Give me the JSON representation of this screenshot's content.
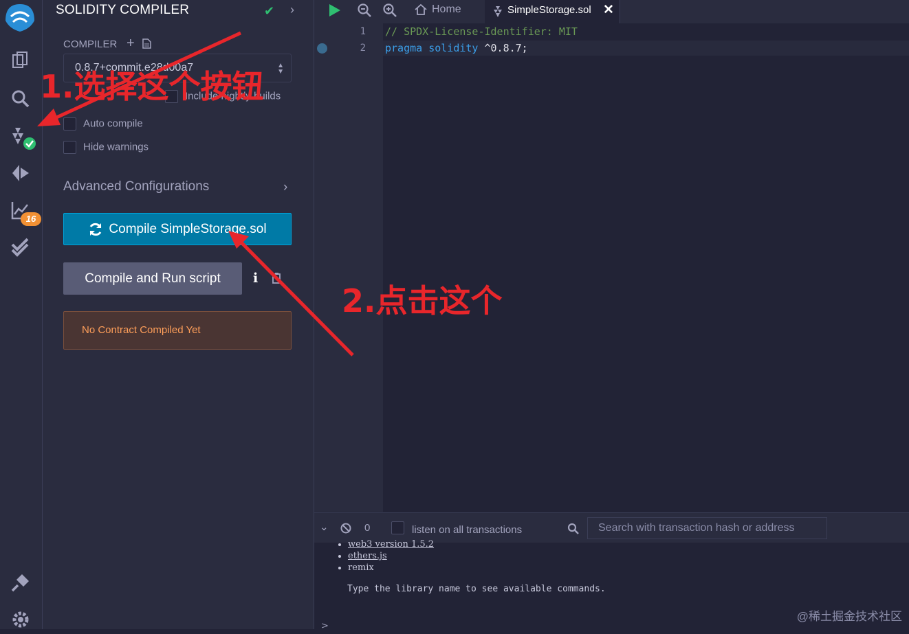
{
  "sidebar": {
    "icons": [
      "remix-logo-icon",
      "file-explorer-icon",
      "search-icon",
      "solidity-compiler-icon",
      "deploy-run-icon",
      "analysis-icon",
      "test-icon",
      "plugin-manager-icon",
      "settings-icon"
    ],
    "analysis_badge": "16"
  },
  "panel": {
    "title": "SOLIDITY COMPILER",
    "compiler_label": "COMPILER",
    "compiler_version": "0.8.7+commit.e28d00a7",
    "nightly_label": "Include nightly builds",
    "auto_compile_label": "Auto compile",
    "hide_warnings_label": "Hide warnings",
    "advanced_label": "Advanced Configurations",
    "compile_button": "Compile SimpleStorage.sol",
    "run_button": "Compile and Run script",
    "alert_text": "No Contract Compiled Yet"
  },
  "tabs": {
    "home_label": "Home",
    "active_file": "SimpleStorage.sol"
  },
  "editor": {
    "lines": [
      {
        "num": "1",
        "comment": "// SPDX-License-Identifier: MIT"
      },
      {
        "num": "2",
        "kw1": "pragma",
        "kw2": "solidity",
        "rest": "^0.8.7;"
      }
    ]
  },
  "terminal": {
    "count": "0",
    "listen_label": "listen on all transactions",
    "search_placeholder": "Search with transaction hash or address",
    "libs": [
      "web3 version 1.5.2",
      "ethers.js",
      "remix"
    ],
    "hint": "Type the library name to see available commands.",
    "prompt": ">"
  },
  "annotations": {
    "step1": "1.选择这个按钮",
    "step2": "2.点击这个"
  },
  "watermark": "@稀土掘金技术社区",
  "colors": {
    "accent": "#007aa6",
    "annotation": "#e8262b",
    "success": "#2fbf71",
    "badge": "#f29134"
  }
}
